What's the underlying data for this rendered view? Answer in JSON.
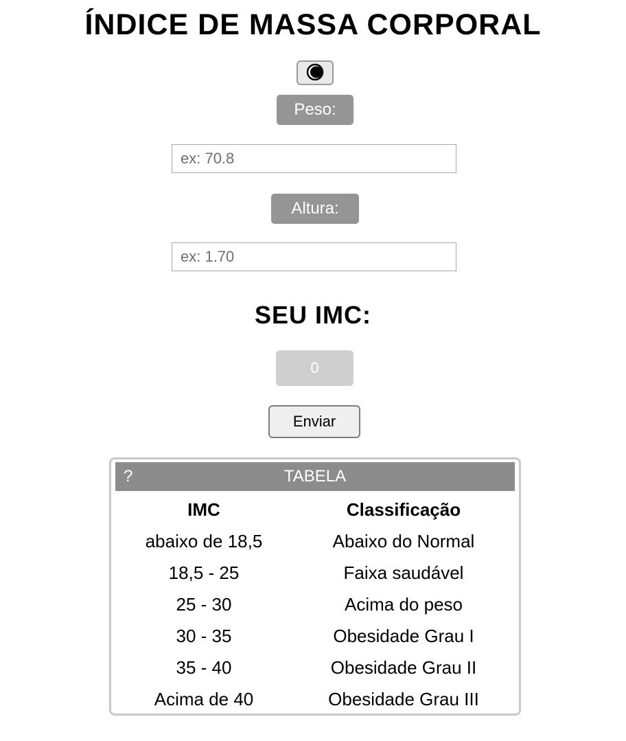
{
  "header": {
    "title": "ÍNDICE DE MASSA CORPORAL"
  },
  "theme_toggle": {
    "icon": "half-moon-icon"
  },
  "form": {
    "weight_label": "Peso:",
    "weight_placeholder": "ex: 70.8",
    "weight_value": "",
    "height_label": "Altura:",
    "height_placeholder": "ex: 1.70",
    "height_value": ""
  },
  "result": {
    "heading": "SEU IMC:",
    "value": "0"
  },
  "submit": {
    "label": "Enviar"
  },
  "table": {
    "help_icon": "?",
    "title": "TABELA",
    "columns": [
      "IMC",
      "Classificação"
    ],
    "rows": [
      [
        "abaixo de 18,5",
        "Abaixo do Normal"
      ],
      [
        "18,5 - 25",
        "Faixa saudável"
      ],
      [
        "25 - 30",
        "Acima do peso"
      ],
      [
        "30 - 35",
        "Obesidade Grau I"
      ],
      [
        "35 - 40",
        "Obesidade Grau II"
      ],
      [
        "Acima de 40",
        "Obesidade Grau III"
      ]
    ]
  },
  "colors": {
    "label_bg": "#959595",
    "table_header_bg": "#8c8c8c",
    "result_bg": "#cfcfcf"
  }
}
